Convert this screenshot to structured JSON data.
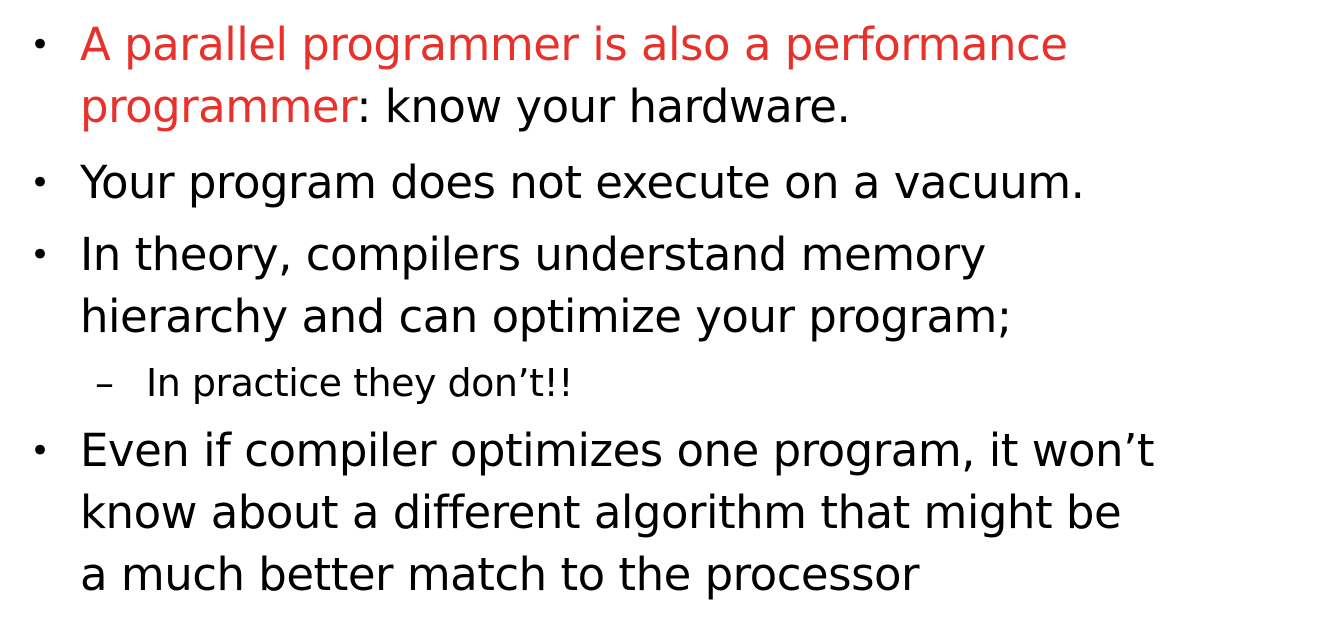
{
  "bullets": [
    {
      "symbol": "•",
      "red_text": "A parallel programmer is also a performance",
      "red_text_line2": "programmer",
      "rest_line2": ": know your hardware."
    },
    {
      "symbol": "•",
      "line1": "Your program does not execute on a vacuum."
    },
    {
      "symbol": "•",
      "line1": "In theory, compilers understand  memory",
      "line2": "hierarchy and can optimize your program;"
    },
    {
      "symbol": "•",
      "line1": "Even if compiler optimizes one program, it won’t",
      "line2": "know about a different algorithm that might be",
      "line3": "a much better match to the processor"
    }
  ],
  "sub_bullet": {
    "symbol": "–",
    "text": "In practice they don’t!!"
  },
  "colors": {
    "highlight": "#e8312a",
    "text": "#000000",
    "background": "#ffffff"
  }
}
